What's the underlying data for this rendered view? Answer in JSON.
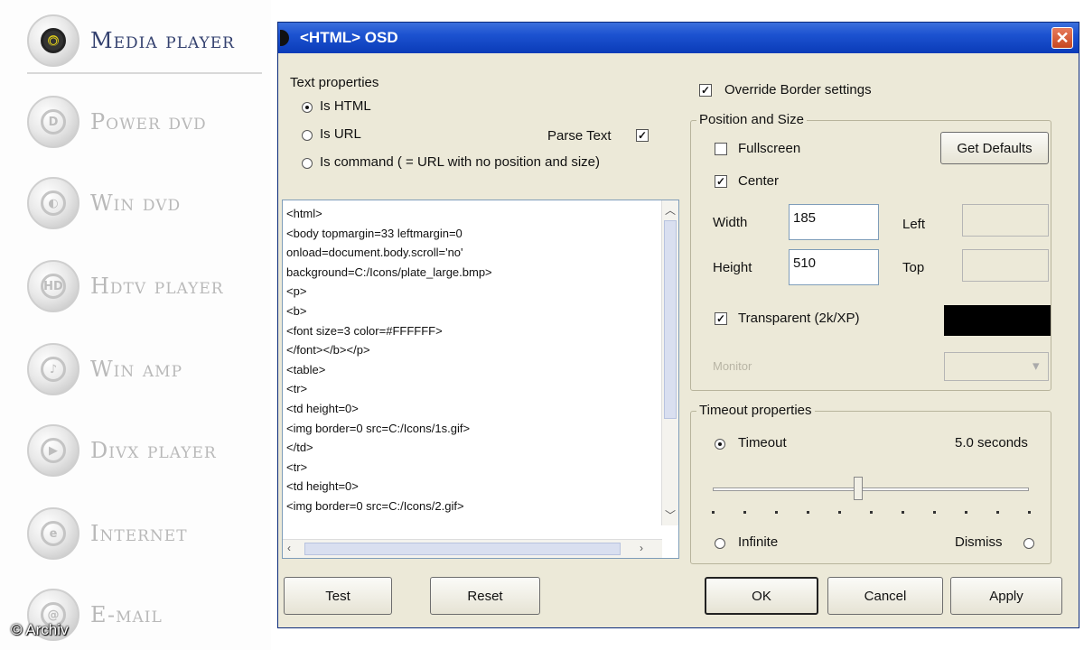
{
  "launcher": {
    "items": [
      {
        "label": "Media player",
        "icon": "disc-icon",
        "glyph": "◉"
      },
      {
        "label": "Power dvd",
        "icon": "dvd-icon",
        "glyph": "D"
      },
      {
        "label": "Win dvd",
        "icon": "dvd-icon",
        "glyph": "◐"
      },
      {
        "label": "Hdtv player",
        "icon": "hdtv-icon",
        "glyph": "HD"
      },
      {
        "label": "Win amp",
        "icon": "music-icon",
        "glyph": "♪"
      },
      {
        "label": "Divx player",
        "icon": "video-icon",
        "glyph": "▶"
      },
      {
        "label": "Internet",
        "icon": "globe-icon",
        "glyph": "e"
      },
      {
        "label": "E-mail",
        "icon": "mail-icon",
        "glyph": "@"
      }
    ],
    "credit": "© Archiv"
  },
  "dialog": {
    "title": "<HTML> OSD",
    "close_glyph": "✕",
    "text_props": {
      "legend": "Text properties",
      "is_html": "Is HTML",
      "is_url": "Is URL",
      "is_command": "Is command ( = URL with no position and size)",
      "parse_text": "Parse Text",
      "parse_checked": "✓",
      "selected": "is_html"
    },
    "code_lines": [
      "<html>",
      "<body topmargin=33 leftmargin=0",
      "onload=document.body.scroll='no'",
      "background=C:/Icons/plate_large.bmp>",
      "<p>",
      "<b>",
      "<font size=3 color=#FFFFFF>",
      "</font></b></p>",
      "<table>",
      "<tr>",
      "<td height=0>",
      "<img border=0 src=C:/Icons/1s.gif>",
      "</td>",
      "<tr>",
      "<td height=0>",
      "<img border=0 src=C:/Icons/2.gif>"
    ],
    "override": {
      "label": "Override Border settings",
      "checked": "✓"
    },
    "position_size": {
      "legend": "Position and Size",
      "fullscreen": "Fullscreen",
      "center": "Center",
      "center_checked": "✓",
      "get_defaults": "Get Defaults",
      "width_label": "Width",
      "width_value": "185",
      "height_label": "Height",
      "height_value": "510",
      "left_label": "Left",
      "left_value": "",
      "top_label": "Top",
      "top_value": "",
      "transparent": "Transparent (2k/XP)",
      "transparent_checked": "✓",
      "transparent_color": "#000000",
      "monitor_label": "Monitor",
      "monitor_value": ""
    },
    "timeout": {
      "legend": "Timeout properties",
      "timeout_label": "Timeout",
      "seconds": "5.0 seconds",
      "slider_fraction": 0.46,
      "infinite_label": "Infinite",
      "dismiss_label": "Dismiss",
      "selected": "timeout"
    },
    "buttons": {
      "test": "Test",
      "reset": "Reset",
      "ok": "OK",
      "cancel": "Cancel",
      "apply": "Apply"
    }
  }
}
